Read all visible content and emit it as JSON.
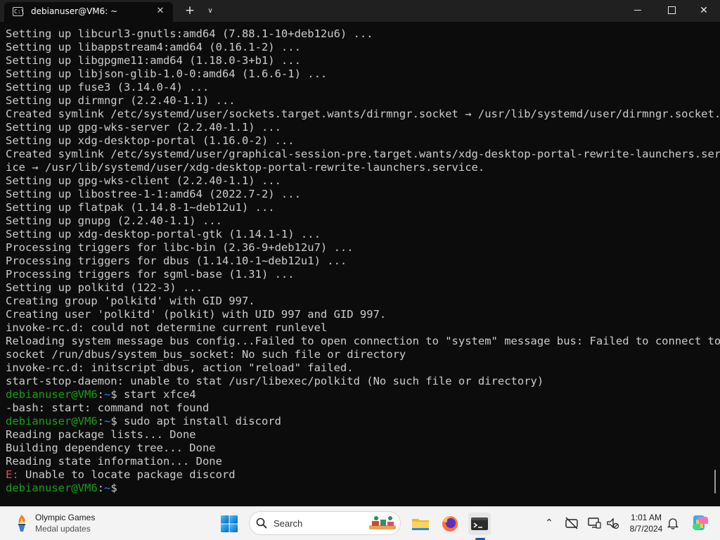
{
  "window": {
    "tab_title": "debianuser@VM6: ~",
    "tab_icon_text": "C:\\",
    "new_tab_glyph": "+",
    "dropdown_glyph": "∨",
    "close_tab_glyph": "✕",
    "close_window_glyph": "✕"
  },
  "terminal": {
    "lines": [
      {
        "type": "text",
        "text": "Setting up libcurl3-gnutls:amd64 (7.88.1-10+deb12u6) ..."
      },
      {
        "type": "text",
        "text": "Setting up libappstream4:amd64 (0.16.1-2) ..."
      },
      {
        "type": "text",
        "text": "Setting up libgpgme11:amd64 (1.18.0-3+b1) ..."
      },
      {
        "type": "text",
        "text": "Setting up libjson-glib-1.0-0:amd64 (1.6.6-1) ..."
      },
      {
        "type": "text",
        "text": "Setting up fuse3 (3.14.0-4) ..."
      },
      {
        "type": "text",
        "text": "Setting up dirmngr (2.2.40-1.1) ..."
      },
      {
        "type": "text",
        "text": "Created symlink /etc/systemd/user/sockets.target.wants/dirmngr.socket → /usr/lib/systemd/user/dirmngr.socket."
      },
      {
        "type": "text",
        "text": "Setting up gpg-wks-server (2.2.40-1.1) ..."
      },
      {
        "type": "text",
        "text": "Setting up xdg-desktop-portal (1.16.0-2) ..."
      },
      {
        "type": "text",
        "text": "Created symlink /etc/systemd/user/graphical-session-pre.target.wants/xdg-desktop-portal-rewrite-launchers.serv"
      },
      {
        "type": "text",
        "text": "ice → /usr/lib/systemd/user/xdg-desktop-portal-rewrite-launchers.service."
      },
      {
        "type": "text",
        "text": "Setting up gpg-wks-client (2.2.40-1.1) ..."
      },
      {
        "type": "text",
        "text": "Setting up libostree-1-1:amd64 (2022.7-2) ..."
      },
      {
        "type": "text",
        "text": "Setting up flatpak (1.14.8-1~deb12u1) ..."
      },
      {
        "type": "text",
        "text": "Setting up gnupg (2.2.40-1.1) ..."
      },
      {
        "type": "text",
        "text": "Setting up xdg-desktop-portal-gtk (1.14.1-1) ..."
      },
      {
        "type": "text",
        "text": "Processing triggers for libc-bin (2.36-9+deb12u7) ..."
      },
      {
        "type": "text",
        "text": "Processing triggers for dbus (1.14.10-1~deb12u1) ..."
      },
      {
        "type": "text",
        "text": "Processing triggers for sgml-base (1.31) ..."
      },
      {
        "type": "text",
        "text": "Setting up polkitd (122-3) ..."
      },
      {
        "type": "text",
        "text": "Creating group 'polkitd' with GID 997."
      },
      {
        "type": "text",
        "text": "Creating user 'polkitd' (polkit) with UID 997 and GID 997."
      },
      {
        "type": "text",
        "text": "invoke-rc.d: could not determine current runlevel"
      },
      {
        "type": "text",
        "text": "Reloading system message bus config...Failed to open connection to \"system\" message bus: Failed to connect to"
      },
      {
        "type": "text",
        "text": "socket /run/dbus/system_bus_socket: No such file or directory"
      },
      {
        "type": "text",
        "text": "invoke-rc.d: initscript dbus, action \"reload\" failed."
      },
      {
        "type": "text",
        "text": "start-stop-daemon: unable to stat /usr/libexec/polkitd (No such file or directory)"
      },
      {
        "type": "prompt",
        "user": "debianuser@VM6",
        "sep": ":",
        "path": "~",
        "cmd": "$ start xfce4"
      },
      {
        "type": "text",
        "text": "-bash: start: command not found"
      },
      {
        "type": "prompt",
        "user": "debianuser@VM6",
        "sep": ":",
        "path": "~",
        "cmd": "$ sudo apt install discord"
      },
      {
        "type": "text",
        "text": "Reading package lists... Done"
      },
      {
        "type": "text",
        "text": "Building dependency tree... Done"
      },
      {
        "type": "text",
        "text": "Reading state information... Done"
      },
      {
        "type": "error",
        "prefix": "E:",
        "text": " Unable to locate package discord"
      },
      {
        "type": "prompt",
        "user": "debianuser@VM6",
        "sep": ":",
        "path": "~",
        "cmd": "$"
      }
    ]
  },
  "taskbar": {
    "widget_title": "Olympic Games",
    "widget_subtitle": "Medal updates",
    "search_placeholder": "Search",
    "clock_time": "1:01 AM",
    "clock_date": "8/7/2024",
    "tray_chevron": "⌃"
  },
  "colors": {
    "terminal_bg": "#0c0c0c",
    "terminal_fg": "#cccccc",
    "prompt_user": "#13a10e",
    "prompt_path": "#3b78ff",
    "error": "#e74856",
    "taskbar_bg": "#f3f3f3"
  }
}
